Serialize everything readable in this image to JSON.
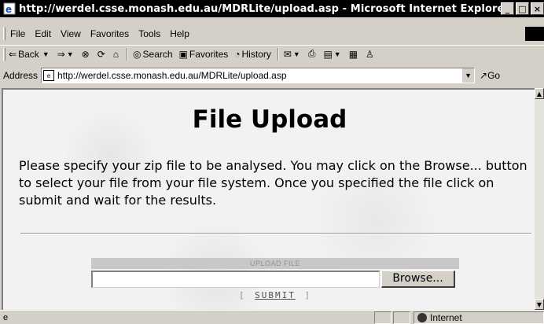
{
  "window": {
    "title": "http://werdel.csse.monash.edu.au/MDRLite/upload.asp - Microsoft Internet Explorer",
    "controls": [
      "_",
      "□",
      "×"
    ]
  },
  "menu": [
    "File",
    "Edit",
    "View",
    "Favorites",
    "Tools",
    "Help"
  ],
  "toolbar": {
    "back": "Back",
    "search": "Search",
    "favorites": "Favorites",
    "history": "History"
  },
  "address": {
    "label": "Address",
    "url": "http://werdel.csse.monash.edu.au/MDRLite/upload.asp",
    "go": "Go"
  },
  "page": {
    "title": "File Upload",
    "intro": "Please specify your zip file to be analysed. You may click on the Browse... button to select your file from your file system. Once you specified the file click on submit and wait for the results.",
    "upload_header": "UPLOAD FILE",
    "file_value": "",
    "browse": "Browse...",
    "submit": "SUBMIT"
  },
  "status": {
    "zone": "Internet"
  }
}
